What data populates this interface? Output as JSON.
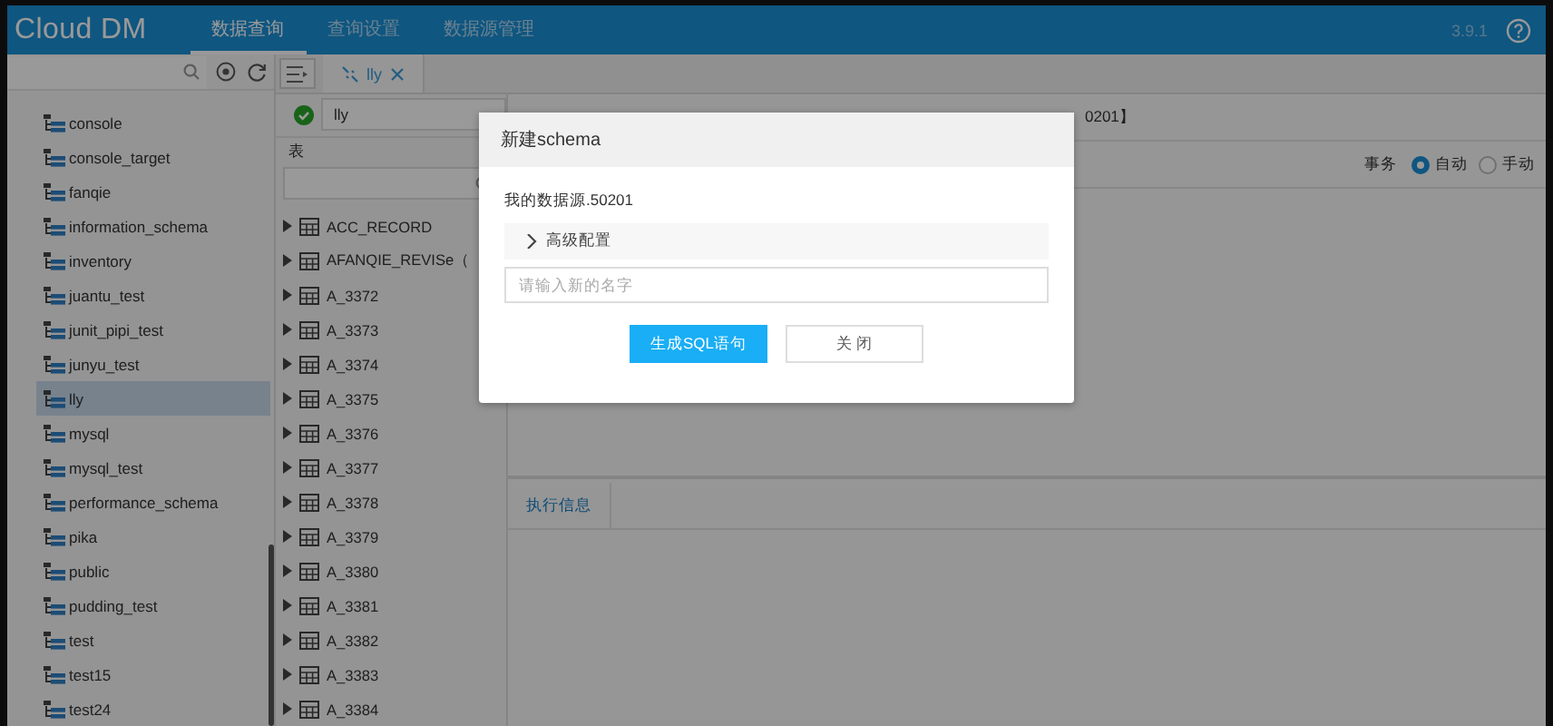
{
  "header": {
    "logo": "Cloud DM",
    "nav": [
      {
        "label": "数据查询",
        "selected": true
      },
      {
        "label": "查询设置",
        "selected": false
      },
      {
        "label": "数据源管理",
        "selected": false
      }
    ],
    "version": "3.9.1"
  },
  "sidebar": {
    "schemas": [
      {
        "name": "console",
        "selected": false
      },
      {
        "name": "console_target",
        "selected": false
      },
      {
        "name": "fanqie",
        "selected": false
      },
      {
        "name": "information_schema",
        "selected": false
      },
      {
        "name": "inventory",
        "selected": false
      },
      {
        "name": "juantu_test",
        "selected": false
      },
      {
        "name": "junit_pipi_test",
        "selected": false
      },
      {
        "name": "junyu_test",
        "selected": false
      },
      {
        "name": "lly",
        "selected": true
      },
      {
        "name": "mysql",
        "selected": false
      },
      {
        "name": "mysql_test",
        "selected": false
      },
      {
        "name": "performance_schema",
        "selected": false
      },
      {
        "name": "pika",
        "selected": false
      },
      {
        "name": "public",
        "selected": false
      },
      {
        "name": "pudding_test",
        "selected": false
      },
      {
        "name": "test",
        "selected": false
      },
      {
        "name": "test15",
        "selected": false
      },
      {
        "name": "test24",
        "selected": false
      }
    ]
  },
  "editor_tabs": [
    {
      "label": "lly",
      "selected": true
    }
  ],
  "table_panel": {
    "schema": "lly",
    "connected": true,
    "label": "表",
    "tables": [
      "ACC_RECORD",
      "AFANQIE_REVISe（",
      "A_3372",
      "A_3373",
      "A_3374",
      "A_3375",
      "A_3376",
      "A_3377",
      "A_3378",
      "A_3379",
      "A_3380",
      "A_3381",
      "A_3382",
      "A_3383",
      "A_3384"
    ]
  },
  "editor": {
    "datasource": "0201】",
    "transaction": {
      "label": "事务",
      "options": [
        {
          "label": "自动",
          "selected": true
        },
        {
          "label": "手动",
          "selected": false
        }
      ]
    },
    "result_tabs": [
      {
        "label": "执行信息",
        "selected": true
      }
    ]
  },
  "dialog": {
    "title": "新建schema",
    "datasource": "我的数据源.50201",
    "advanced": {
      "label": "高级配置",
      "expanded": false
    },
    "name_field": {
      "placeholder": "请输入新的名字"
    },
    "buttons": [
      {
        "label": "生成SQL语句",
        "kind": "primary"
      },
      {
        "label": "关 闭",
        "kind": "default"
      }
    ]
  }
}
